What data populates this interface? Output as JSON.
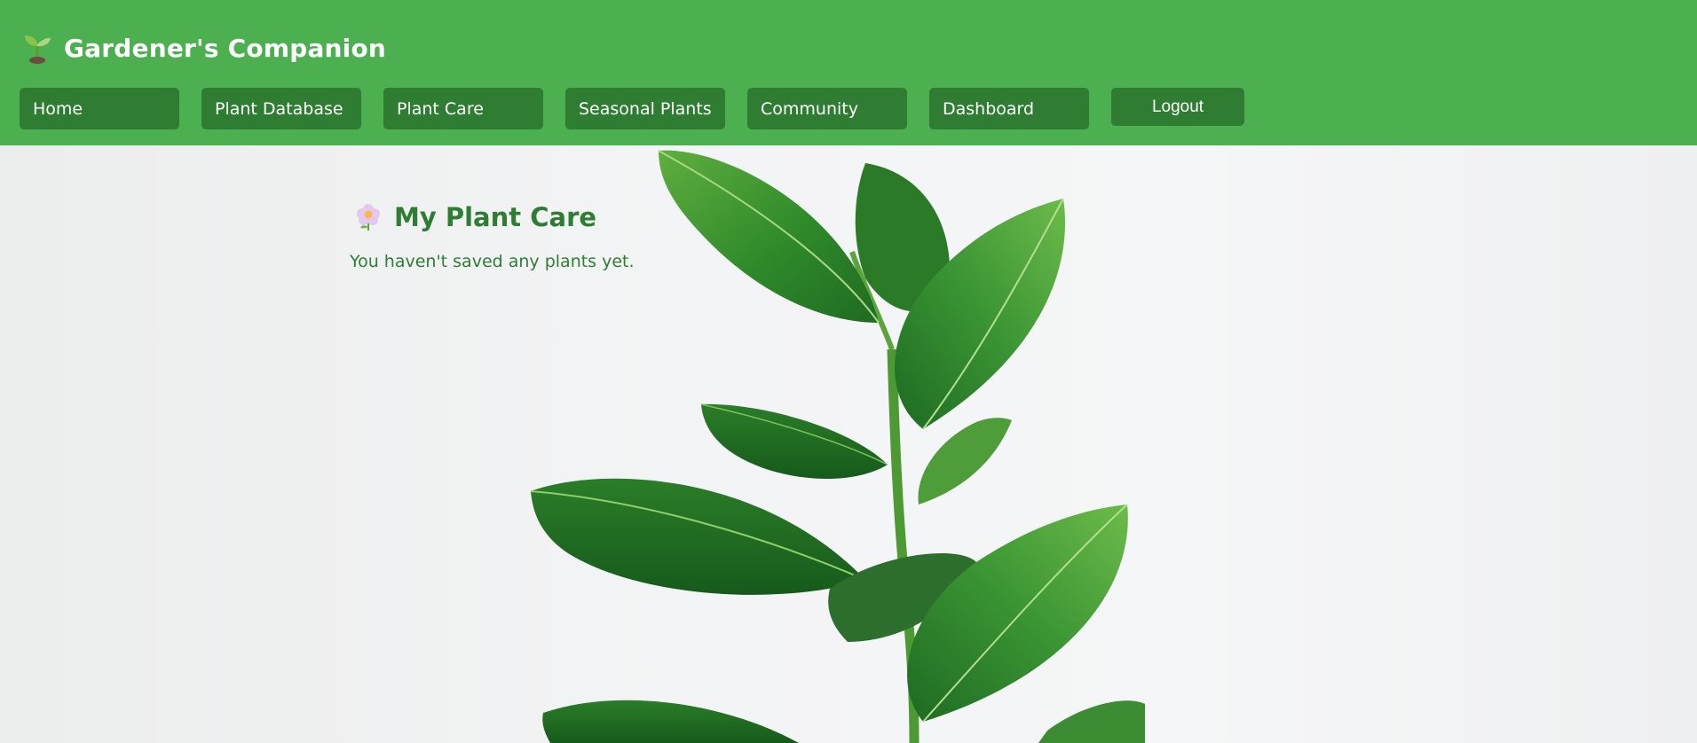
{
  "app": {
    "title": "Gardener's Companion",
    "logo_icon": "seedling-icon"
  },
  "nav": {
    "items": [
      {
        "label": "Home"
      },
      {
        "label": "Plant Database"
      },
      {
        "label": "Plant Care"
      },
      {
        "label": "Seasonal Plants"
      },
      {
        "label": "Community"
      },
      {
        "label": "Dashboard"
      }
    ],
    "logout_label": "Logout"
  },
  "main": {
    "title": "My Plant Care",
    "title_icon": "blossom-icon",
    "empty_message": "You haven't saved any plants yet."
  },
  "colors": {
    "header_bg": "#4caf50",
    "nav_button_bg": "#2e7d32",
    "heading_text": "#2e7d32",
    "page_bg": "#f1f2f3"
  }
}
